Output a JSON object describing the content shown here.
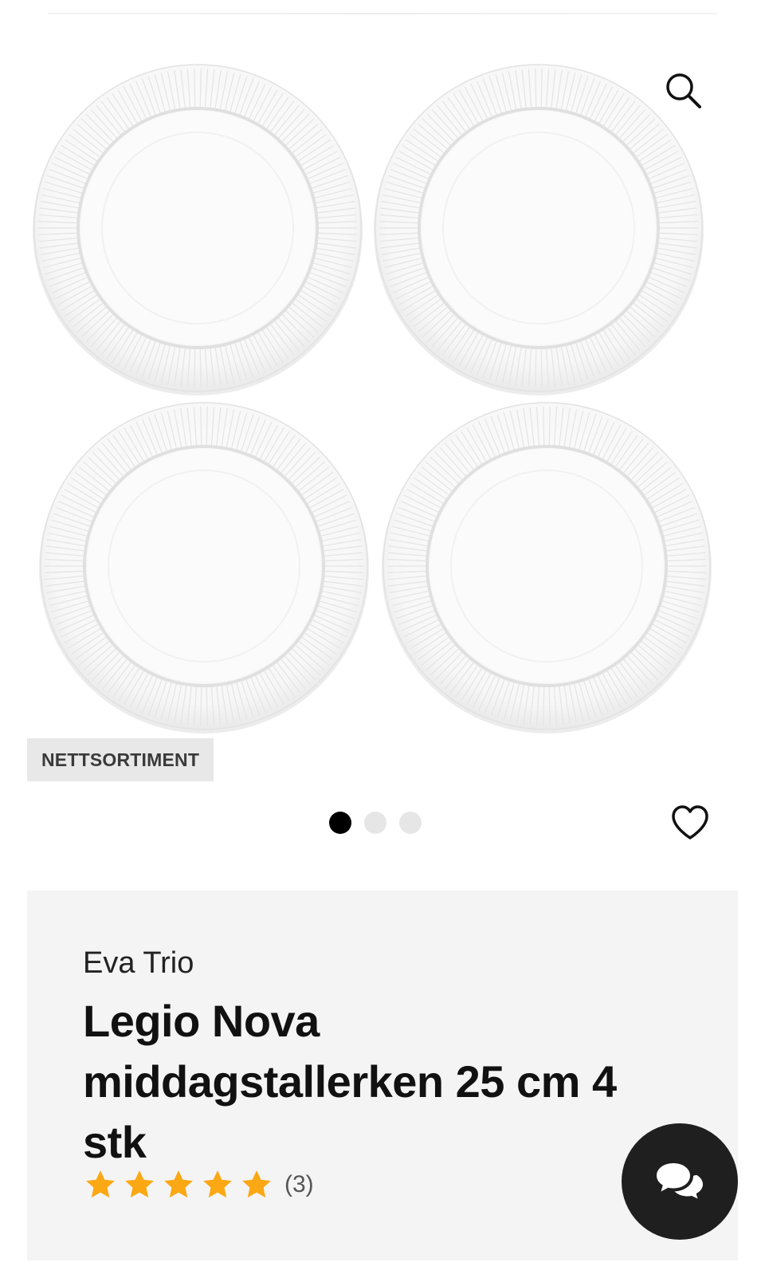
{
  "badge": {
    "label": "NETTSORTIMENT"
  },
  "carousel": {
    "count": 3,
    "active_index": 0
  },
  "product": {
    "brand": "Eva Trio",
    "title": "Legio Nova middagstallerken 25 cm 4 stk",
    "rating": {
      "stars": 5,
      "max": 5,
      "review_count": "(3)"
    }
  },
  "icons": {
    "zoom": "search-icon",
    "favorite": "heart-icon",
    "chat": "chat-bubbles-icon",
    "star": "star-icon"
  },
  "colors": {
    "star": "#FBA814",
    "chat_bg": "#1F1F1F",
    "badge_bg": "#E8E8E8",
    "card_bg": "#F4F4F4",
    "dot_active": "#000000",
    "dot_inactive": "#E6E6E6"
  }
}
